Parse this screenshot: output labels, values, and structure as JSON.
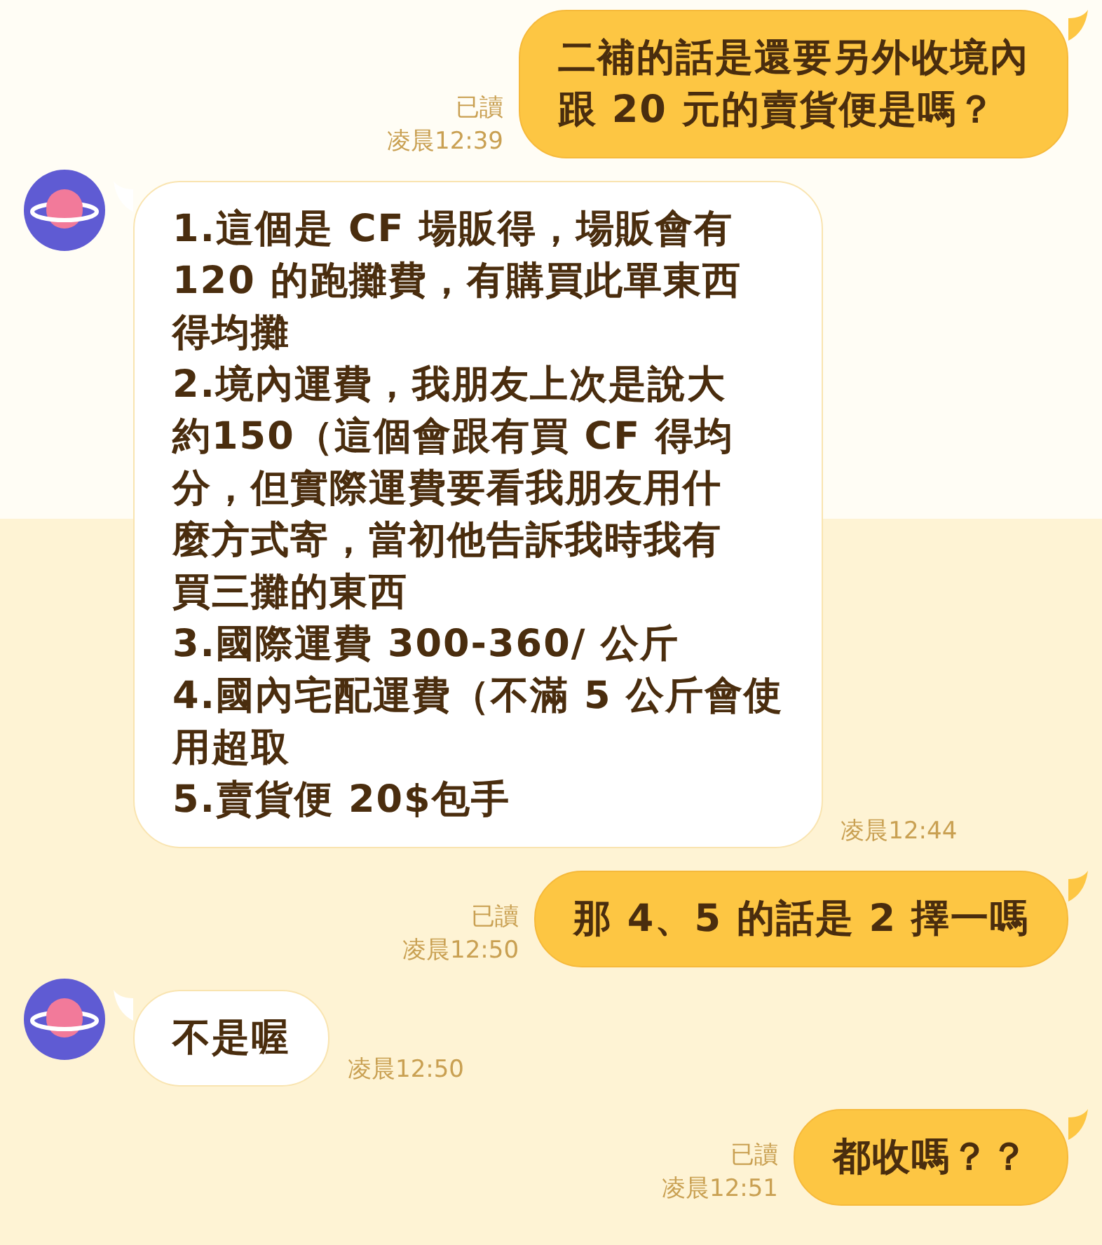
{
  "messages": [
    {
      "kind": "outgoing",
      "read_label": "已讀",
      "time": "凌晨12:39",
      "lines": [
        "二補的話是還要另外收境內",
        "跟 20 元的賣貨便是嗎？"
      ]
    },
    {
      "kind": "incoming",
      "time": "凌晨12:44",
      "lines": [
        "1.這個是 CF 場販得，場販會有",
        "120 的跑攤費，有購買此單東西",
        "得均攤",
        "2.境內運費，我朋友上次是說大",
        "約150（這個會跟有買 CF 得均",
        "分，但實際運費要看我朋友用什",
        "麼方式寄，當初他告訴我時我有",
        "買三攤的東西",
        "3.國際運費 300-360/ 公斤",
        "4.國內宅配運費（不滿 5 公斤會使",
        "用超取",
        "5.賣貨便 20$包手"
      ]
    },
    {
      "kind": "outgoing",
      "read_label": "已讀",
      "time": "凌晨12:50",
      "lines": [
        "那 4、5 的話是 2 擇一嗎"
      ]
    },
    {
      "kind": "incoming",
      "time": "凌晨12:50",
      "lines": [
        "不是喔"
      ]
    },
    {
      "kind": "outgoing",
      "read_label": "已讀",
      "time": "凌晨12:51",
      "lines": [
        "都收嗎？？"
      ]
    }
  ]
}
